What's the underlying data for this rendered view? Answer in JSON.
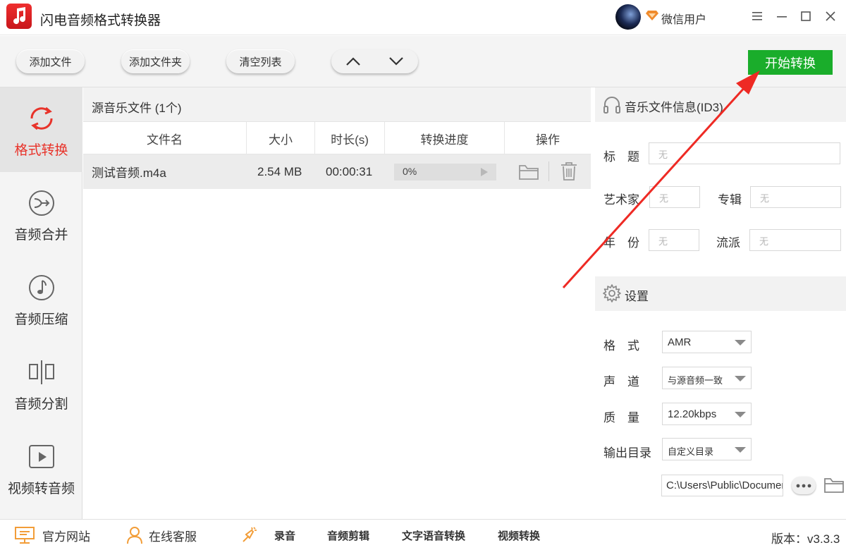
{
  "app": {
    "title": "闪电音频格式转换器",
    "user_name": "微信用户"
  },
  "toolbar": {
    "add_file": "添加文件",
    "add_folder": "添加文件夹",
    "clear_list": "清空列表",
    "start": "开始转换"
  },
  "nav": [
    {
      "label": "格式转换",
      "icon": "refresh-icon",
      "active": true
    },
    {
      "label": "音频合并",
      "icon": "merge-icon",
      "active": false
    },
    {
      "label": "音频压缩",
      "icon": "music-note-icon",
      "active": false
    },
    {
      "label": "音频分割",
      "icon": "split-icon",
      "active": false
    },
    {
      "label": "视频转音频",
      "icon": "video-play-icon",
      "active": false
    }
  ],
  "file_list": {
    "title": "源音乐文件 (1个)",
    "columns": [
      "文件名",
      "大小",
      "时长(s)",
      "转换进度",
      "操作"
    ],
    "rows": [
      {
        "name": "测试音频.m4a",
        "size": "2.54 MB",
        "duration": "00:00:31",
        "progress_text": "0%",
        "progress": 0
      }
    ]
  },
  "id3": {
    "title": "音乐文件信息(ID3)",
    "title_label": "标　题",
    "artist_label": "艺术家",
    "album_label": "专辑",
    "year_label": "年　份",
    "genre_label": "流派",
    "placeholder": "无"
  },
  "settings": {
    "title": "设置",
    "format_label": "格　式",
    "format_value": "AMR",
    "channel_label": "声　道",
    "channel_value": "与源音频一致",
    "quality_label": "质　量",
    "quality_value": "12.20kbps",
    "output_label": "输出目录",
    "output_value": "自定义目录",
    "output_path": "C:\\Users\\Public\\Documents"
  },
  "bottom": {
    "website": "官方网站",
    "support": "在线客服",
    "record": "录音",
    "audio_cut": "音频剪辑",
    "tts": "文字语音转换",
    "video_convert": "视频转换",
    "version": "版本：v3.3.3"
  },
  "colors": {
    "accent_red": "#e8332a",
    "start_green": "#1aad2b",
    "annotation_red": "#ee2a24"
  }
}
